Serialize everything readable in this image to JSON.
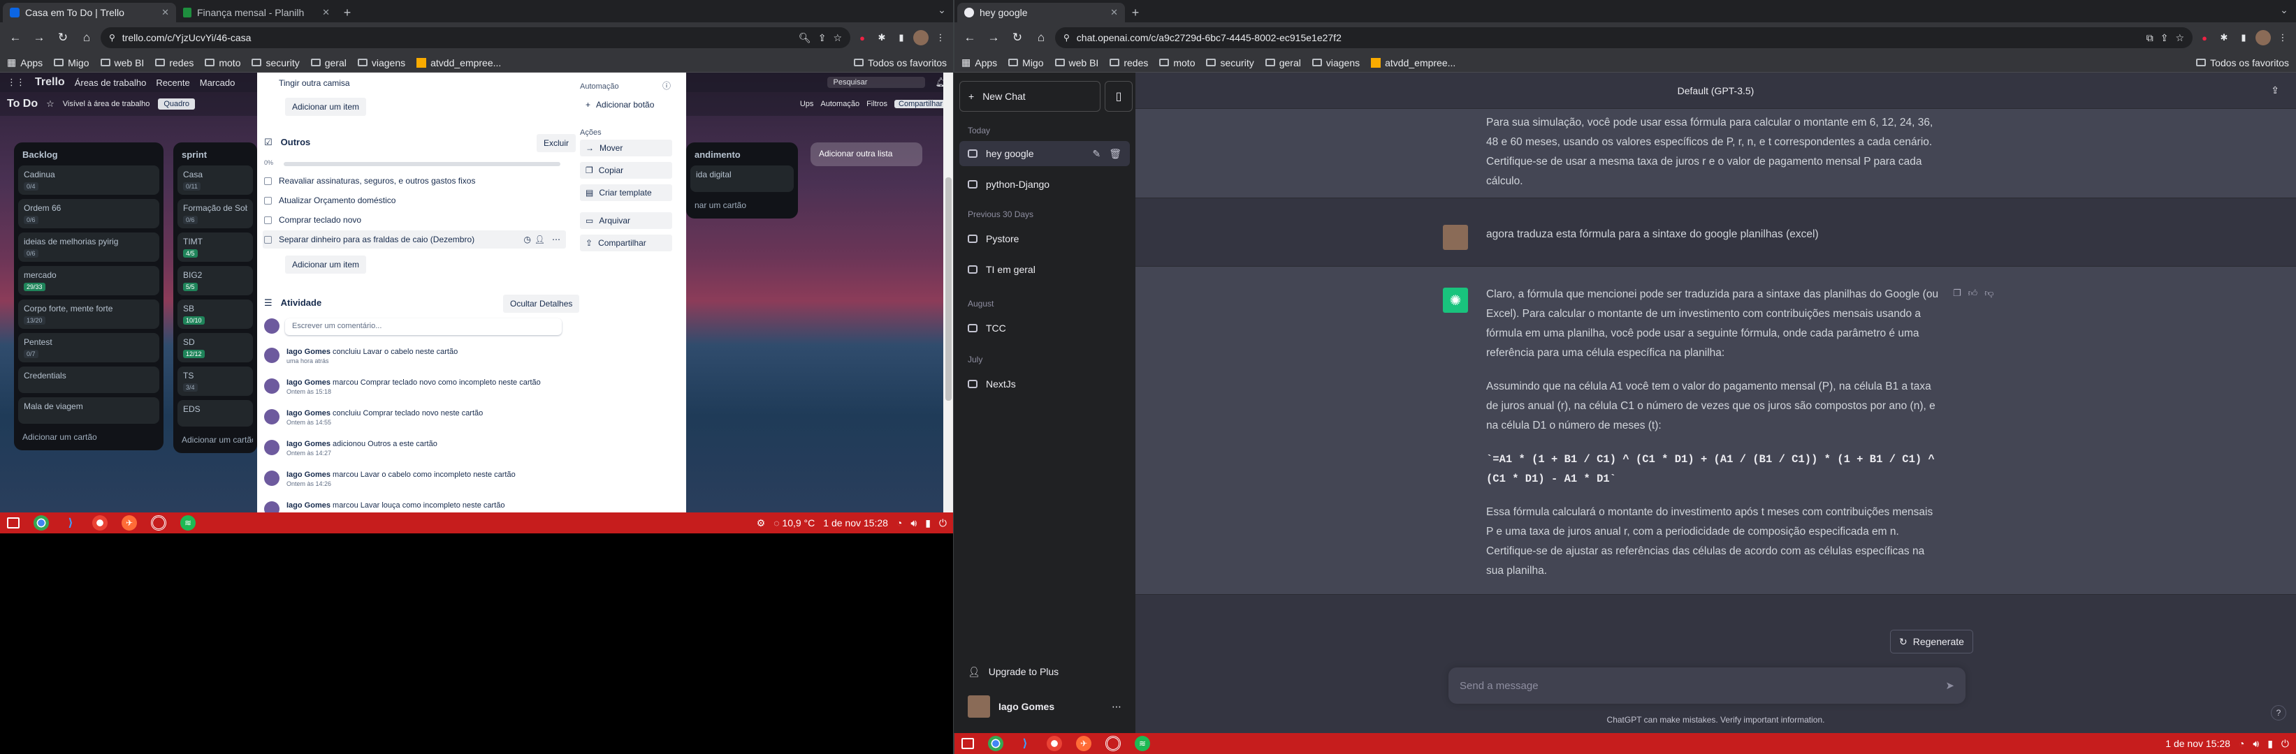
{
  "left_window": {
    "tabs": [
      {
        "label": "Casa em To Do | Trello",
        "active": true
      },
      {
        "label": "Finança mensal - Planilh",
        "active": false
      }
    ],
    "url": "trello.com/c/YjzUcvYi/46-casa",
    "bookmarks": [
      "Apps",
      "Migo",
      "web BI",
      "redes",
      "moto",
      "security",
      "geral",
      "viagens",
      "atvdd_empree..."
    ],
    "bookmarks_right": "Todos os favoritos",
    "trello": {
      "logo": "Trello",
      "header_items": [
        "Áreas de trabalho",
        "Recente",
        "Marcado"
      ],
      "search": "Pesquisar",
      "board_title": "To Do",
      "board_visibility": "Visível à área de trabalho",
      "board_view": "Quadro",
      "board_right": [
        "Ups",
        "Automação",
        "Filtros",
        "Compartilhar"
      ],
      "lists": [
        {
          "title": "Backlog",
          "cards": [
            {
              "t": "Cadinua",
              "b": "0/4"
            },
            {
              "t": "Ordem 66",
              "b": "0/6"
            },
            {
              "t": "ideias de melhorias pyirig",
              "b": "0/6"
            },
            {
              "t": "mercado",
              "b": "29/33"
            },
            {
              "t": "Corpo forte, mente forte",
              "b": "13/20"
            },
            {
              "t": "Pentest",
              "b": "0/7"
            },
            {
              "t": "Credentials",
              "b": ""
            },
            {
              "t": "Mala de viagem",
              "b": ""
            }
          ],
          "add": "Adicionar um cartão"
        },
        {
          "title": "sprint",
          "cards": [
            {
              "t": "Casa",
              "b": "0/11"
            },
            {
              "t": "Formação de Sobrev",
              "b": "0/6"
            },
            {
              "t": "TIMT",
              "b": "4/5"
            },
            {
              "t": "BIG2",
              "b": "5/5"
            },
            {
              "t": "SB",
              "b": "10/10"
            },
            {
              "t": "SD",
              "b": "12/12"
            },
            {
              "t": "TS",
              "b": "3/4"
            },
            {
              "t": "EDS",
              "b": ""
            }
          ],
          "add": "Adicionar um cartão"
        }
      ],
      "right_list": {
        "title": "andimento",
        "card": "ida digital",
        "add": "nar um cartão"
      },
      "add_list": "Adicionar outra lista"
    },
    "card_modal": {
      "top_item": "Tingir outra camisa",
      "add_item_1": "Adicionar um item",
      "checklist_title": "Outros",
      "delete_btn": "Excluir",
      "progress": "0%",
      "items": [
        "Reavaliar assinaturas, seguros, e outros gastos fixos",
        "Atualizar Orçamento doméstico",
        "Comprar teclado novo",
        "Separar dinheiro para as fraldas de caio (Dezembro)"
      ],
      "add_item_2": "Adicionar um item",
      "activity_title": "Atividade",
      "hide_details": "Ocultar Detalhes",
      "comment_placeholder": "Escrever um comentário...",
      "activities": [
        {
          "user": "Iago Gomes",
          "text": "concluiu Lavar o cabelo neste cartão",
          "time": "uma hora atrás"
        },
        {
          "user": "Iago Gomes",
          "text": "marcou Comprar teclado novo como incompleto neste cartão",
          "time": "Ontem às 15:18"
        },
        {
          "user": "Iago Gomes",
          "text": "concluiu Comprar teclado novo neste cartão",
          "time": "Ontem às 14:55"
        },
        {
          "user": "Iago Gomes",
          "text": "adicionou Outros a este cartão",
          "time": "Ontem às 14:27"
        },
        {
          "user": "Iago Gomes",
          "text": "marcou Lavar o cabelo como incompleto neste cartão",
          "time": "Ontem às 14:26"
        },
        {
          "user": "Iago Gomes",
          "text": "marcou Lavar louça como incompleto neste cartão",
          "time": ""
        }
      ],
      "automation_label": "Automação",
      "add_button": "Adicionar botão",
      "actions_label": "Ações",
      "actions": [
        "Mover",
        "Copiar",
        "Criar template",
        "Arquivar",
        "Compartilhar"
      ]
    },
    "taskbar": {
      "weather": "10,9 °C",
      "datetime": "1 de nov 15:28"
    }
  },
  "right_window": {
    "tabs": [
      {
        "label": "hey google",
        "active": true
      }
    ],
    "url": "chat.openai.com/c/a9c2729d-6bc7-4445-8002-ec915e1e27f2",
    "bookmarks": [
      "Apps",
      "Migo",
      "web BI",
      "redes",
      "moto",
      "security",
      "geral",
      "viagens",
      "atvdd_empree..."
    ],
    "bookmarks_right": "Todos os favoritos",
    "chatgpt": {
      "new_chat": "New Chat",
      "groups": [
        {
          "label": "Today",
          "items": [
            "hey google",
            "python-Django"
          ]
        },
        {
          "label": "Previous 30 Days",
          "items": [
            "Pystore",
            "TI em geral"
          ]
        },
        {
          "label": "August",
          "items": [
            "TCC"
          ]
        },
        {
          "label": "July",
          "items": [
            "NextJs"
          ]
        }
      ],
      "upgrade": "Upgrade to Plus",
      "user": "Iago Gomes",
      "model": "Default (GPT-3.5)",
      "prev_answer": "Para sua simulação, você pode usar essa fórmula para calcular o montante em 6, 12, 24, 36, 48 e 60 meses, usando os valores específicos de P, r, n, e t correspondentes a cada cenário. Certifique-se de usar a mesma taxa de juros r e o valor de pagamento mensal P para cada cálculo.",
      "user_msg": "agora traduza esta fórmula para a sintaxe do google planilhas (excel)",
      "answer_p1": "Claro, a fórmula que mencionei pode ser traduzida para a sintaxe das planilhas do Google (ou Excel). Para calcular o montante de um investimento com contribuições mensais usando a fórmula em uma planilha, você pode usar a seguinte fórmula, onde cada parâmetro é uma referência para uma célula específica na planilha:",
      "answer_p2": "Assumindo que na célula A1 você tem o valor do pagamento mensal (P), na célula B1 a taxa de juros anual (r), na célula C1 o número de vezes que os juros são compostos por ano (n), e na célula D1 o número de meses (t):",
      "answer_code": "`=A1 * (1 + B1 / C1) ^ (C1 * D1) + (A1 / (B1 / C1)) * (1 + B1 / C1) ^ (C1 * D1) - A1 * D1`",
      "answer_p3": "Essa fórmula calculará o montante do investimento após t meses com contribuições mensais P e uma taxa de juros anual r, com a periodicidade de composição especificada em n. Certifique-se de ajustar as referências das células de acordo com as células específicas na sua planilha.",
      "regenerate": "Regenerate",
      "input_placeholder": "Send a message",
      "footnote": "ChatGPT can make mistakes. Verify important information."
    },
    "taskbar": {
      "datetime": "1 de nov 15:28"
    }
  },
  "colors": {
    "taskbar": "#c61d1d",
    "chat_bg": "#343541",
    "sidebar_bg": "#202123",
    "ai_msg_bg": "#444654"
  }
}
